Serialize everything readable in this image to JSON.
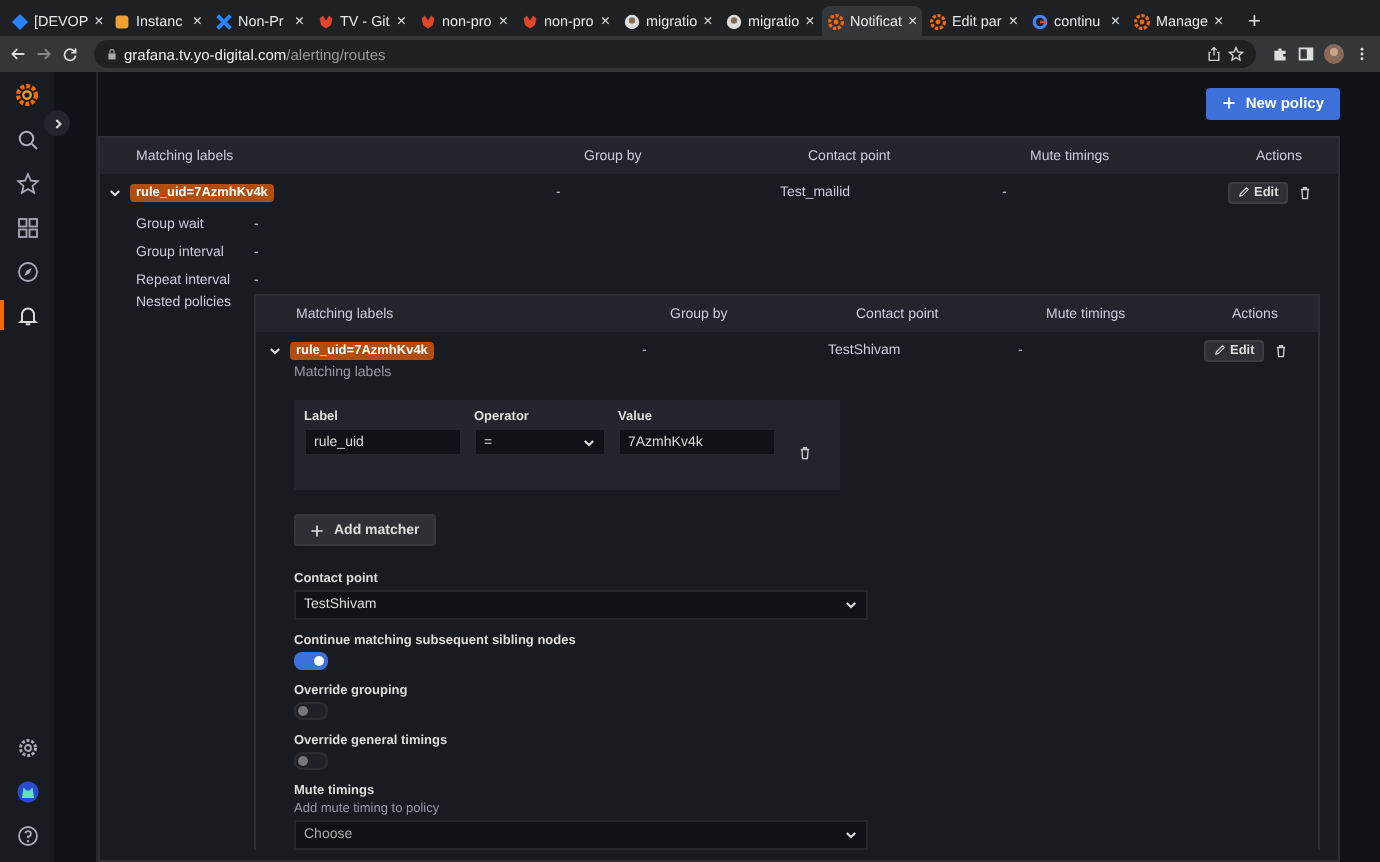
{
  "browser": {
    "tabs": [
      {
        "title": "[DEVOP",
        "kind": "diamond",
        "selected": false,
        "close": "×"
      },
      {
        "title": "Instanc",
        "kind": "box",
        "selected": false,
        "close": "×"
      },
      {
        "title": "Non-Pr",
        "kind": "cross",
        "selected": false,
        "close": "×"
      },
      {
        "title": "TV - Git",
        "kind": "fox",
        "selected": false,
        "close": "×"
      },
      {
        "title": "non-pro",
        "kind": "fox",
        "selected": false,
        "close": "×"
      },
      {
        "title": "non-pro",
        "kind": "fox",
        "selected": false,
        "close": "×"
      },
      {
        "title": "migratio",
        "kind": "person",
        "selected": false,
        "close": "×"
      },
      {
        "title": "migratio",
        "kind": "person",
        "selected": false,
        "close": "×"
      },
      {
        "title": "Notificat",
        "kind": "sun",
        "selected": true,
        "close": "×"
      },
      {
        "title": "Edit par",
        "kind": "sun",
        "selected": false,
        "close": "×"
      },
      {
        "title": "continu",
        "kind": "ring",
        "selected": false,
        "close": "×"
      },
      {
        "title": "Manage",
        "kind": "sun",
        "selected": false,
        "close": "×"
      }
    ],
    "new_tab": "+",
    "url_host": "grafana.tv.yo-digital.com",
    "url_path": "/alerting/routes"
  },
  "sidebar": {
    "items": [
      {
        "kind": "search",
        "selected": false
      },
      {
        "kind": "star",
        "selected": false
      },
      {
        "kind": "apps",
        "selected": false
      },
      {
        "kind": "compass",
        "selected": false
      },
      {
        "kind": "bell",
        "selected": true
      }
    ],
    "bottom": [
      {
        "kind": "gear"
      },
      {
        "kind": "avatar"
      },
      {
        "kind": "help"
      }
    ]
  },
  "new_policy_button": "New policy",
  "policies": {
    "columns": [
      "Matching labels",
      "Group by",
      "Contact point",
      "Mute timings",
      "Actions"
    ],
    "row": {
      "label": "rule_uid=7AzmhKv4k",
      "group_by": "-",
      "contact_point": "Test_mailid",
      "mute_timings": "-",
      "edit": "Edit",
      "expanded": true
    },
    "details": [
      {
        "label": "Group wait",
        "value": "-"
      },
      {
        "label": "Group interval",
        "value": "-"
      },
      {
        "label": "Repeat interval",
        "value": "-"
      }
    ],
    "nested_label": "Nested policies",
    "nested": {
      "columns": [
        "Matching labels",
        "Group by",
        "Contact point",
        "Mute timings",
        "Actions"
      ],
      "row": {
        "label": "rule_uid=7AzmhKv4k",
        "group_by": "-",
        "contact_point": "TestShivam",
        "mute_timings": "-",
        "edit": "Edit",
        "expanded": true
      },
      "form": {
        "matchers_title": "Matching labels",
        "matcher": {
          "label_title": "Label",
          "label_value": "rule_uid",
          "operator_title": "Operator",
          "operator_value": "=",
          "value_title": "Value",
          "value_value": "7AzmhKv4k"
        },
        "add_matcher": "Add matcher",
        "contact_point": {
          "title": "Contact point",
          "value": "TestShivam"
        },
        "toggles": [
          {
            "label": "Continue matching subsequent sibling nodes",
            "on": true
          },
          {
            "label": "Override grouping",
            "on": false
          },
          {
            "label": "Override general timings",
            "on": false
          }
        ],
        "mute_timings": {
          "title": "Mute timings",
          "description": "Add mute timing to policy",
          "placeholder": "Choose"
        }
      }
    }
  }
}
